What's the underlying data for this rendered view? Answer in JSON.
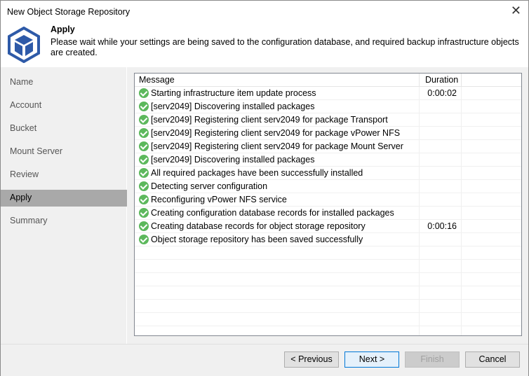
{
  "window": {
    "title": "New Object Storage Repository",
    "close": "✕"
  },
  "header": {
    "title": "Apply",
    "description": "Please wait while your settings are being saved to the configuration database, and required backup infrastructure objects are created."
  },
  "sidebar": {
    "items": [
      {
        "label": "Name"
      },
      {
        "label": "Account"
      },
      {
        "label": "Bucket"
      },
      {
        "label": "Mount Server"
      },
      {
        "label": "Review"
      },
      {
        "label": "Apply",
        "selected": true
      },
      {
        "label": "Summary"
      }
    ]
  },
  "table": {
    "columns": [
      "Message",
      "Duration"
    ],
    "rows": [
      {
        "message": "Starting infrastructure item update process",
        "duration": "0:00:02"
      },
      {
        "message": "[serv2049] Discovering installed packages",
        "duration": ""
      },
      {
        "message": "[serv2049] Registering client serv2049 for package Transport",
        "duration": ""
      },
      {
        "message": "[serv2049] Registering client serv2049 for package vPower NFS",
        "duration": ""
      },
      {
        "message": "[serv2049] Registering client serv2049 for package Mount Server",
        "duration": ""
      },
      {
        "message": "[serv2049] Discovering installed packages",
        "duration": ""
      },
      {
        "message": "All required packages have been successfully installed",
        "duration": ""
      },
      {
        "message": "Detecting server configuration",
        "duration": ""
      },
      {
        "message": "Reconfiguring vPower NFS service",
        "duration": ""
      },
      {
        "message": "Creating configuration database records for installed packages",
        "duration": ""
      },
      {
        "message": "Creating database records for object storage repository",
        "duration": "0:00:16"
      },
      {
        "message": "Object storage repository has been saved successfully",
        "duration": ""
      }
    ]
  },
  "buttons": {
    "previous": "< Previous",
    "next": "Next >",
    "finish": "Finish",
    "cancel": "Cancel"
  }
}
